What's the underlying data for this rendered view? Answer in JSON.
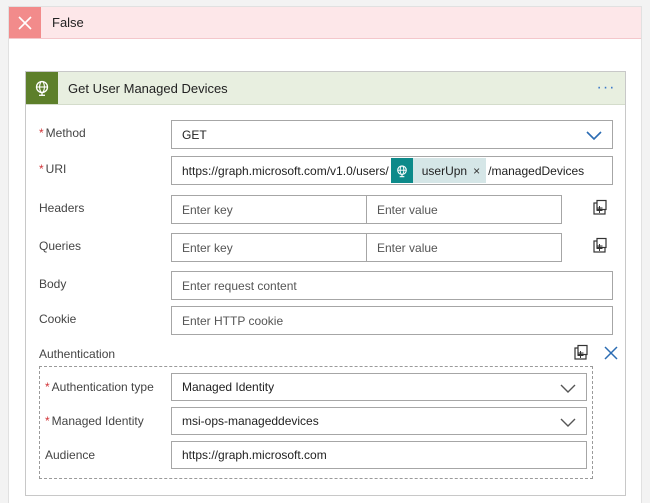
{
  "condition": {
    "title": "False"
  },
  "action": {
    "title": "Get User Managed Devices",
    "more_label": "···"
  },
  "fields": {
    "method": {
      "label": "Method",
      "value": "GET"
    },
    "uri": {
      "label": "URI",
      "prefix": "https://graph.microsoft.com/v1.0/users/",
      "token": "userUpn",
      "token_remove": "×",
      "suffix": "/managedDevices"
    },
    "headers": {
      "label": "Headers",
      "key_placeholder": "Enter key",
      "value_placeholder": "Enter value"
    },
    "queries": {
      "label": "Queries",
      "key_placeholder": "Enter key",
      "value_placeholder": "Enter value"
    },
    "body": {
      "label": "Body",
      "placeholder": "Enter request content"
    },
    "cookie": {
      "label": "Cookie",
      "placeholder": "Enter HTTP cookie"
    },
    "authentication": {
      "label": "Authentication",
      "type": {
        "label": "Authentication type",
        "value": "Managed Identity"
      },
      "identity": {
        "label": "Managed Identity",
        "value": "msi-ops-manageddevices"
      },
      "audience": {
        "label": "Audience",
        "value": "https://graph.microsoft.com"
      }
    }
  },
  "required_marker": "*",
  "colors": {
    "false_header_bg": "#fde7e9",
    "false_icon_bg": "#f28b8b",
    "action_header_bg": "#e8efe0",
    "action_icon_bg": "#5d7f2a",
    "token_icon_bg": "#0d8a8a",
    "link_blue": "#3a78c9"
  },
  "icons": {
    "false_icon": "close-icon",
    "action_icon": "globe-icon",
    "token_icon": "globe-icon",
    "switch_mode_icon": "switch-to-text-mode-icon",
    "remove_auth_icon": "close-icon",
    "dropdown_icon": "chevron-down-icon"
  }
}
